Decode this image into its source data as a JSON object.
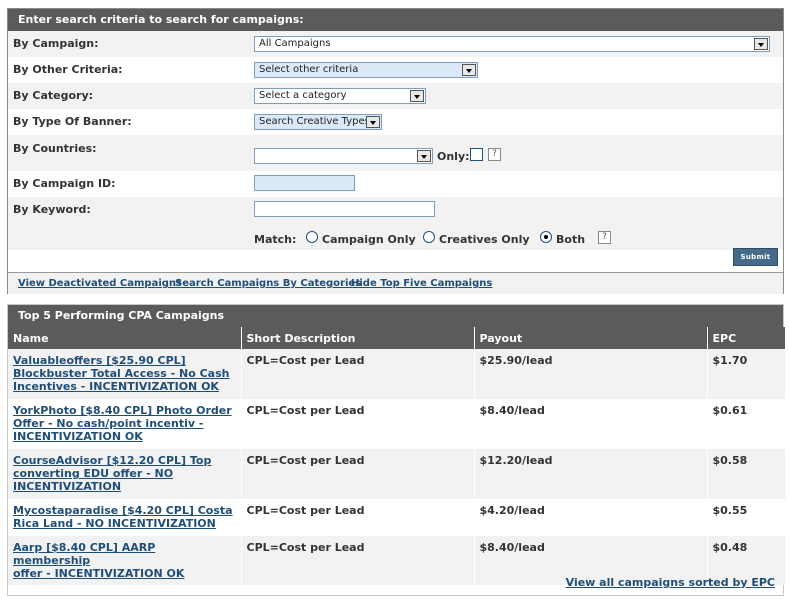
{
  "search": {
    "header": "Enter search criteria to search for campaigns:",
    "campaign": {
      "label": "By Campaign:",
      "value": "All Campaigns"
    },
    "other": {
      "label": "By Other Criteria:",
      "value": "Select other criteria"
    },
    "category": {
      "label": "By Category:",
      "value": "Select a category"
    },
    "banner": {
      "label": "By Type Of Banner:",
      "value": "Search Creative Types"
    },
    "countries": {
      "label": "By Countries:",
      "value": "",
      "only_label": "Only:",
      "help": "?"
    },
    "campaign_id": {
      "label": "By Campaign ID:",
      "value": ""
    },
    "keyword": {
      "label": "By Keyword:",
      "value": ""
    },
    "match": {
      "label": "Match:",
      "options": [
        "Campaign Only",
        "Creatives Only",
        "Both"
      ],
      "selected": "Both",
      "help": "?"
    },
    "submit_label": "Submit",
    "links": [
      "View Deactivated Campaigns",
      "Search Campaigns By Categories",
      "Hide Top Five Campaigns"
    ]
  },
  "top5": {
    "header": "Top 5 Performing CPA Campaigns",
    "columns": [
      "Name",
      "Short Description",
      "Payout",
      "EPC"
    ],
    "rows": [
      {
        "name": [
          "Valuableoffers [$25.90 CPL]",
          "Blockbuster Total Access - No Cash",
          "Incentives - INCENTIVIZATION OK"
        ],
        "desc": "CPL=Cost per Lead",
        "payout": "$25.90/lead",
        "epc": "$1.70"
      },
      {
        "name": [
          "YorkPhoto [$8.40 CPL] Photo Order",
          "Offer - No cash/point incentiv -",
          "INCENTIVIZATION OK"
        ],
        "desc": "CPL=Cost per Lead",
        "payout": "$8.40/lead",
        "epc": "$0.61"
      },
      {
        "name": [
          "CourseAdvisor [$12.20 CPL] Top",
          "converting EDU offer - NO",
          "INCENTIVIZATION"
        ],
        "desc": "CPL=Cost per Lead",
        "payout": "$12.20/lead",
        "epc": "$0.58"
      },
      {
        "name": [
          "Mycostaparadise [$4.20 CPL] Costa",
          "Rica Land - NO INCENTIVIZATION"
        ],
        "desc": "CPL=Cost per Lead",
        "payout": "$4.20/lead",
        "epc": "$0.55"
      },
      {
        "name": [
          "Aarp [$8.40 CPL] AARP membership",
          "offer - INCENTIVIZATION OK"
        ],
        "desc": "CPL=Cost per Lead",
        "payout": "$8.40/lead",
        "epc": "$0.48"
      }
    ],
    "view_all": "View all campaigns sorted by EPC"
  }
}
